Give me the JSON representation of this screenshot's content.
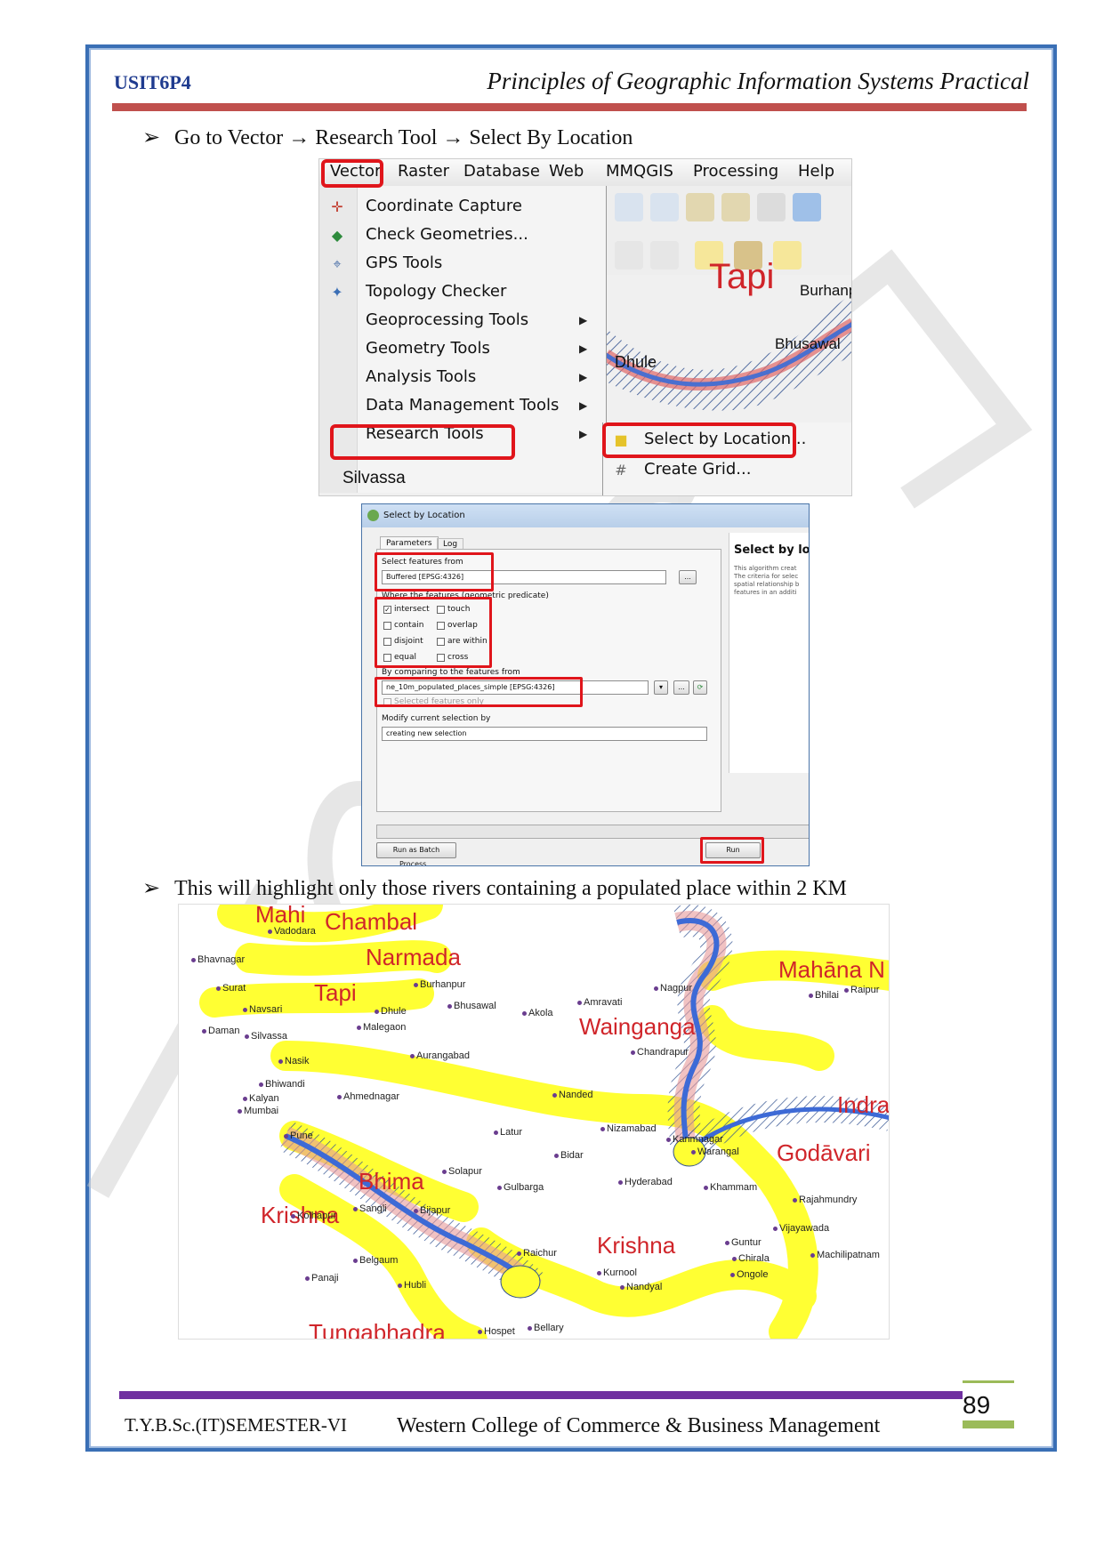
{
  "header": {
    "course_code": "USIT6P4",
    "course_title": "Principles of Geographic Information Systems Practical"
  },
  "bullets": [
    {
      "marker": "➢",
      "text": "Go to Vector → Research Tool → Select By Location"
    },
    {
      "marker": "➢",
      "text": "This will highlight only those rivers containing a populated place within 2 KM"
    }
  ],
  "menu_screenshot": {
    "menubar": [
      "Vector",
      "Raster",
      "Database",
      "Web",
      "MMQGIS",
      "Processing",
      "Help"
    ],
    "vector_menu": [
      {
        "label": "Coordinate Capture",
        "icon": "crosshair-icon",
        "submenu": false
      },
      {
        "label": "Check Geometries...",
        "icon": "check-geometry-icon",
        "submenu": false
      },
      {
        "label": "GPS Tools",
        "icon": "gps-icon",
        "submenu": false
      },
      {
        "label": "Topology Checker",
        "icon": "topology-icon",
        "submenu": false
      },
      {
        "label": "Geoprocessing Tools",
        "icon": "",
        "submenu": true
      },
      {
        "label": "Geometry Tools",
        "icon": "",
        "submenu": true
      },
      {
        "label": "Analysis Tools",
        "icon": "",
        "submenu": true
      },
      {
        "label": "Data Management Tools",
        "icon": "",
        "submenu": true
      },
      {
        "label": "Research Tools",
        "icon": "",
        "submenu": true
      }
    ],
    "research_submenu": [
      "Select by Location...",
      "Create Grid..."
    ],
    "map_labels": {
      "river": "Tapi",
      "places": [
        "Burhanpur",
        "Bhusawal",
        "Dhule",
        "Silvassa"
      ]
    }
  },
  "dialog": {
    "title": "Select by Location",
    "tabs": [
      "Parameters",
      "Log"
    ],
    "select_features_from_label": "Select features from",
    "select_features_from_value": "Buffered [EPSG:4326]",
    "predicate_label": "Where the features (geometric predicate)",
    "predicates": [
      {
        "label": "intersect",
        "checked": true
      },
      {
        "label": "touch",
        "checked": false
      },
      {
        "label": "contain",
        "checked": false
      },
      {
        "label": "overlap",
        "checked": false
      },
      {
        "label": "disjoint",
        "checked": false
      },
      {
        "label": "are within",
        "checked": false
      },
      {
        "label": "equal",
        "checked": false
      },
      {
        "label": "cross",
        "checked": false
      }
    ],
    "compare_label": "By comparing to the features from",
    "compare_value": "ne_10m_populated_places_simple [EPSG:4326]",
    "selected_only_label": "Selected features only",
    "modify_label": "Modify current selection by",
    "modify_value": "creating new selection",
    "help_title": "Select by lo",
    "help_text": [
      "This algorithm creat",
      "The criteria for selec",
      "spatial relationship b",
      "features in an additi"
    ],
    "browse_button": "...",
    "batch_button": "Run as Batch Process...",
    "run_button": "Run"
  },
  "result_map": {
    "rivers": [
      "Mahi",
      "Chambal",
      "Narmada",
      "Tapi",
      "Wainganga",
      "Mahāna N",
      "Indra",
      "Godāvari",
      "Bhima",
      "Krishna",
      "Krishna",
      "Tungabhadra"
    ],
    "places": [
      "Vadodara",
      "Bhavnagar",
      "Surat",
      "Burhanpur",
      "Navsari",
      "Dhule",
      "Bhusawal",
      "Akola",
      "Amravati",
      "Nagpur",
      "Bhilai",
      "Raipur",
      "Daman",
      "Silvassa",
      "Malegaon",
      "Nasik",
      "Aurangabad",
      "Chandrapur",
      "Bhiwandi",
      "Kalyan",
      "Mumbai",
      "Ahmednagar",
      "Nanded",
      "Pune",
      "Latur",
      "Nizamabad",
      "Karimnagar",
      "Warangal",
      "Bidar",
      "Solapur",
      "Gulbarga",
      "Hyderabad",
      "Khammam",
      "Rajahmundry",
      "Kolhapur",
      "Sangli",
      "Bijapur",
      "Vijayawada",
      "Guntur",
      "Chirala",
      "Machilipatnam",
      "Ongole",
      "Raichur",
      "Kurnool",
      "Nandyal",
      "Belgaum",
      "Panaji",
      "Hubli",
      "Hospet",
      "Bellary"
    ]
  },
  "footer": {
    "left": "T.Y.B.Sc.(IT)SEMESTER-VI",
    "right": "Western College of Commerce & Business Management",
    "page_number": "89"
  },
  "colors": {
    "accent_red": "#c0504d",
    "footer_purple": "#7030a0",
    "border_blue": "#3a6fb5",
    "page_green": "#9bbb59",
    "highlight_red": "#e0151b",
    "buffer_yellow": "#ffff33"
  }
}
